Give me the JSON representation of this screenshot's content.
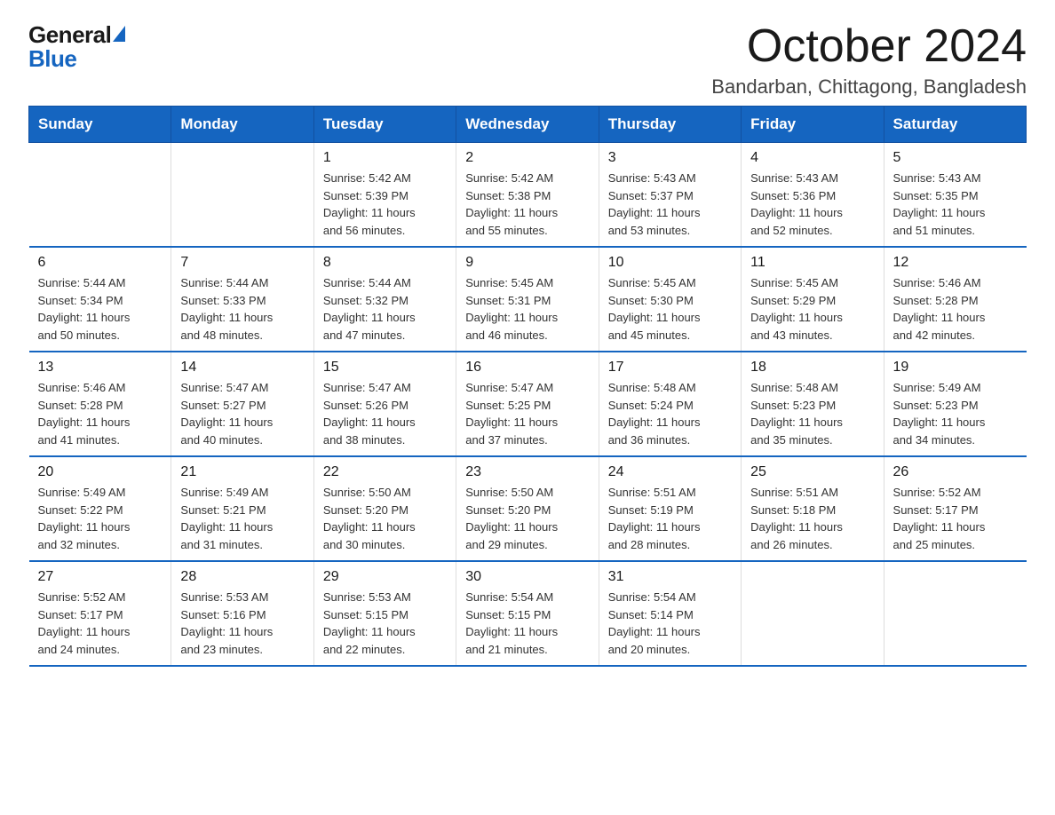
{
  "header": {
    "logo_general": "General",
    "logo_blue": "Blue",
    "title": "October 2024",
    "subtitle": "Bandarban, Chittagong, Bangladesh"
  },
  "calendar": {
    "days_of_week": [
      "Sunday",
      "Monday",
      "Tuesday",
      "Wednesday",
      "Thursday",
      "Friday",
      "Saturday"
    ],
    "weeks": [
      [
        {
          "day": "",
          "info": ""
        },
        {
          "day": "",
          "info": ""
        },
        {
          "day": "1",
          "info": "Sunrise: 5:42 AM\nSunset: 5:39 PM\nDaylight: 11 hours\nand 56 minutes."
        },
        {
          "day": "2",
          "info": "Sunrise: 5:42 AM\nSunset: 5:38 PM\nDaylight: 11 hours\nand 55 minutes."
        },
        {
          "day": "3",
          "info": "Sunrise: 5:43 AM\nSunset: 5:37 PM\nDaylight: 11 hours\nand 53 minutes."
        },
        {
          "day": "4",
          "info": "Sunrise: 5:43 AM\nSunset: 5:36 PM\nDaylight: 11 hours\nand 52 minutes."
        },
        {
          "day": "5",
          "info": "Sunrise: 5:43 AM\nSunset: 5:35 PM\nDaylight: 11 hours\nand 51 minutes."
        }
      ],
      [
        {
          "day": "6",
          "info": "Sunrise: 5:44 AM\nSunset: 5:34 PM\nDaylight: 11 hours\nand 50 minutes."
        },
        {
          "day": "7",
          "info": "Sunrise: 5:44 AM\nSunset: 5:33 PM\nDaylight: 11 hours\nand 48 minutes."
        },
        {
          "day": "8",
          "info": "Sunrise: 5:44 AM\nSunset: 5:32 PM\nDaylight: 11 hours\nand 47 minutes."
        },
        {
          "day": "9",
          "info": "Sunrise: 5:45 AM\nSunset: 5:31 PM\nDaylight: 11 hours\nand 46 minutes."
        },
        {
          "day": "10",
          "info": "Sunrise: 5:45 AM\nSunset: 5:30 PM\nDaylight: 11 hours\nand 45 minutes."
        },
        {
          "day": "11",
          "info": "Sunrise: 5:45 AM\nSunset: 5:29 PM\nDaylight: 11 hours\nand 43 minutes."
        },
        {
          "day": "12",
          "info": "Sunrise: 5:46 AM\nSunset: 5:28 PM\nDaylight: 11 hours\nand 42 minutes."
        }
      ],
      [
        {
          "day": "13",
          "info": "Sunrise: 5:46 AM\nSunset: 5:28 PM\nDaylight: 11 hours\nand 41 minutes."
        },
        {
          "day": "14",
          "info": "Sunrise: 5:47 AM\nSunset: 5:27 PM\nDaylight: 11 hours\nand 40 minutes."
        },
        {
          "day": "15",
          "info": "Sunrise: 5:47 AM\nSunset: 5:26 PM\nDaylight: 11 hours\nand 38 minutes."
        },
        {
          "day": "16",
          "info": "Sunrise: 5:47 AM\nSunset: 5:25 PM\nDaylight: 11 hours\nand 37 minutes."
        },
        {
          "day": "17",
          "info": "Sunrise: 5:48 AM\nSunset: 5:24 PM\nDaylight: 11 hours\nand 36 minutes."
        },
        {
          "day": "18",
          "info": "Sunrise: 5:48 AM\nSunset: 5:23 PM\nDaylight: 11 hours\nand 35 minutes."
        },
        {
          "day": "19",
          "info": "Sunrise: 5:49 AM\nSunset: 5:23 PM\nDaylight: 11 hours\nand 34 minutes."
        }
      ],
      [
        {
          "day": "20",
          "info": "Sunrise: 5:49 AM\nSunset: 5:22 PM\nDaylight: 11 hours\nand 32 minutes."
        },
        {
          "day": "21",
          "info": "Sunrise: 5:49 AM\nSunset: 5:21 PM\nDaylight: 11 hours\nand 31 minutes."
        },
        {
          "day": "22",
          "info": "Sunrise: 5:50 AM\nSunset: 5:20 PM\nDaylight: 11 hours\nand 30 minutes."
        },
        {
          "day": "23",
          "info": "Sunrise: 5:50 AM\nSunset: 5:20 PM\nDaylight: 11 hours\nand 29 minutes."
        },
        {
          "day": "24",
          "info": "Sunrise: 5:51 AM\nSunset: 5:19 PM\nDaylight: 11 hours\nand 28 minutes."
        },
        {
          "day": "25",
          "info": "Sunrise: 5:51 AM\nSunset: 5:18 PM\nDaylight: 11 hours\nand 26 minutes."
        },
        {
          "day": "26",
          "info": "Sunrise: 5:52 AM\nSunset: 5:17 PM\nDaylight: 11 hours\nand 25 minutes."
        }
      ],
      [
        {
          "day": "27",
          "info": "Sunrise: 5:52 AM\nSunset: 5:17 PM\nDaylight: 11 hours\nand 24 minutes."
        },
        {
          "day": "28",
          "info": "Sunrise: 5:53 AM\nSunset: 5:16 PM\nDaylight: 11 hours\nand 23 minutes."
        },
        {
          "day": "29",
          "info": "Sunrise: 5:53 AM\nSunset: 5:15 PM\nDaylight: 11 hours\nand 22 minutes."
        },
        {
          "day": "30",
          "info": "Sunrise: 5:54 AM\nSunset: 5:15 PM\nDaylight: 11 hours\nand 21 minutes."
        },
        {
          "day": "31",
          "info": "Sunrise: 5:54 AM\nSunset: 5:14 PM\nDaylight: 11 hours\nand 20 minutes."
        },
        {
          "day": "",
          "info": ""
        },
        {
          "day": "",
          "info": ""
        }
      ]
    ]
  }
}
